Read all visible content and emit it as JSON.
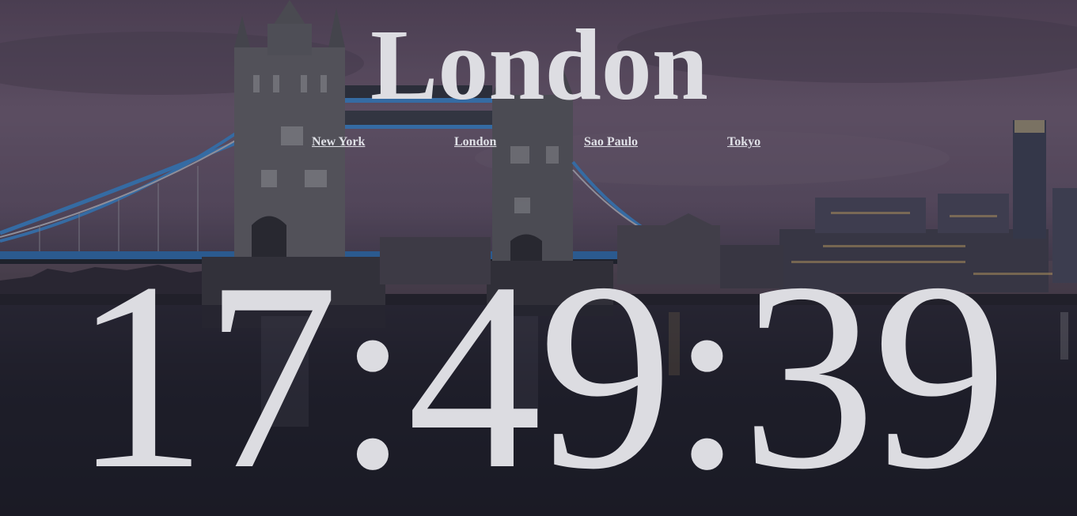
{
  "page": {
    "city_title": "London",
    "time": "17:49:39"
  },
  "nav": {
    "links": [
      {
        "label": "New York"
      },
      {
        "label": "London"
      },
      {
        "label": "Sao Paulo"
      },
      {
        "label": "Tokyo"
      }
    ]
  },
  "background": {
    "subject": "Tower Bridge at dusk over the Thames",
    "colors": {
      "sky": "#5d5066",
      "water": "#1c1d28",
      "text": "#dddde2",
      "bridge_blue": "#2f6aa8"
    }
  }
}
